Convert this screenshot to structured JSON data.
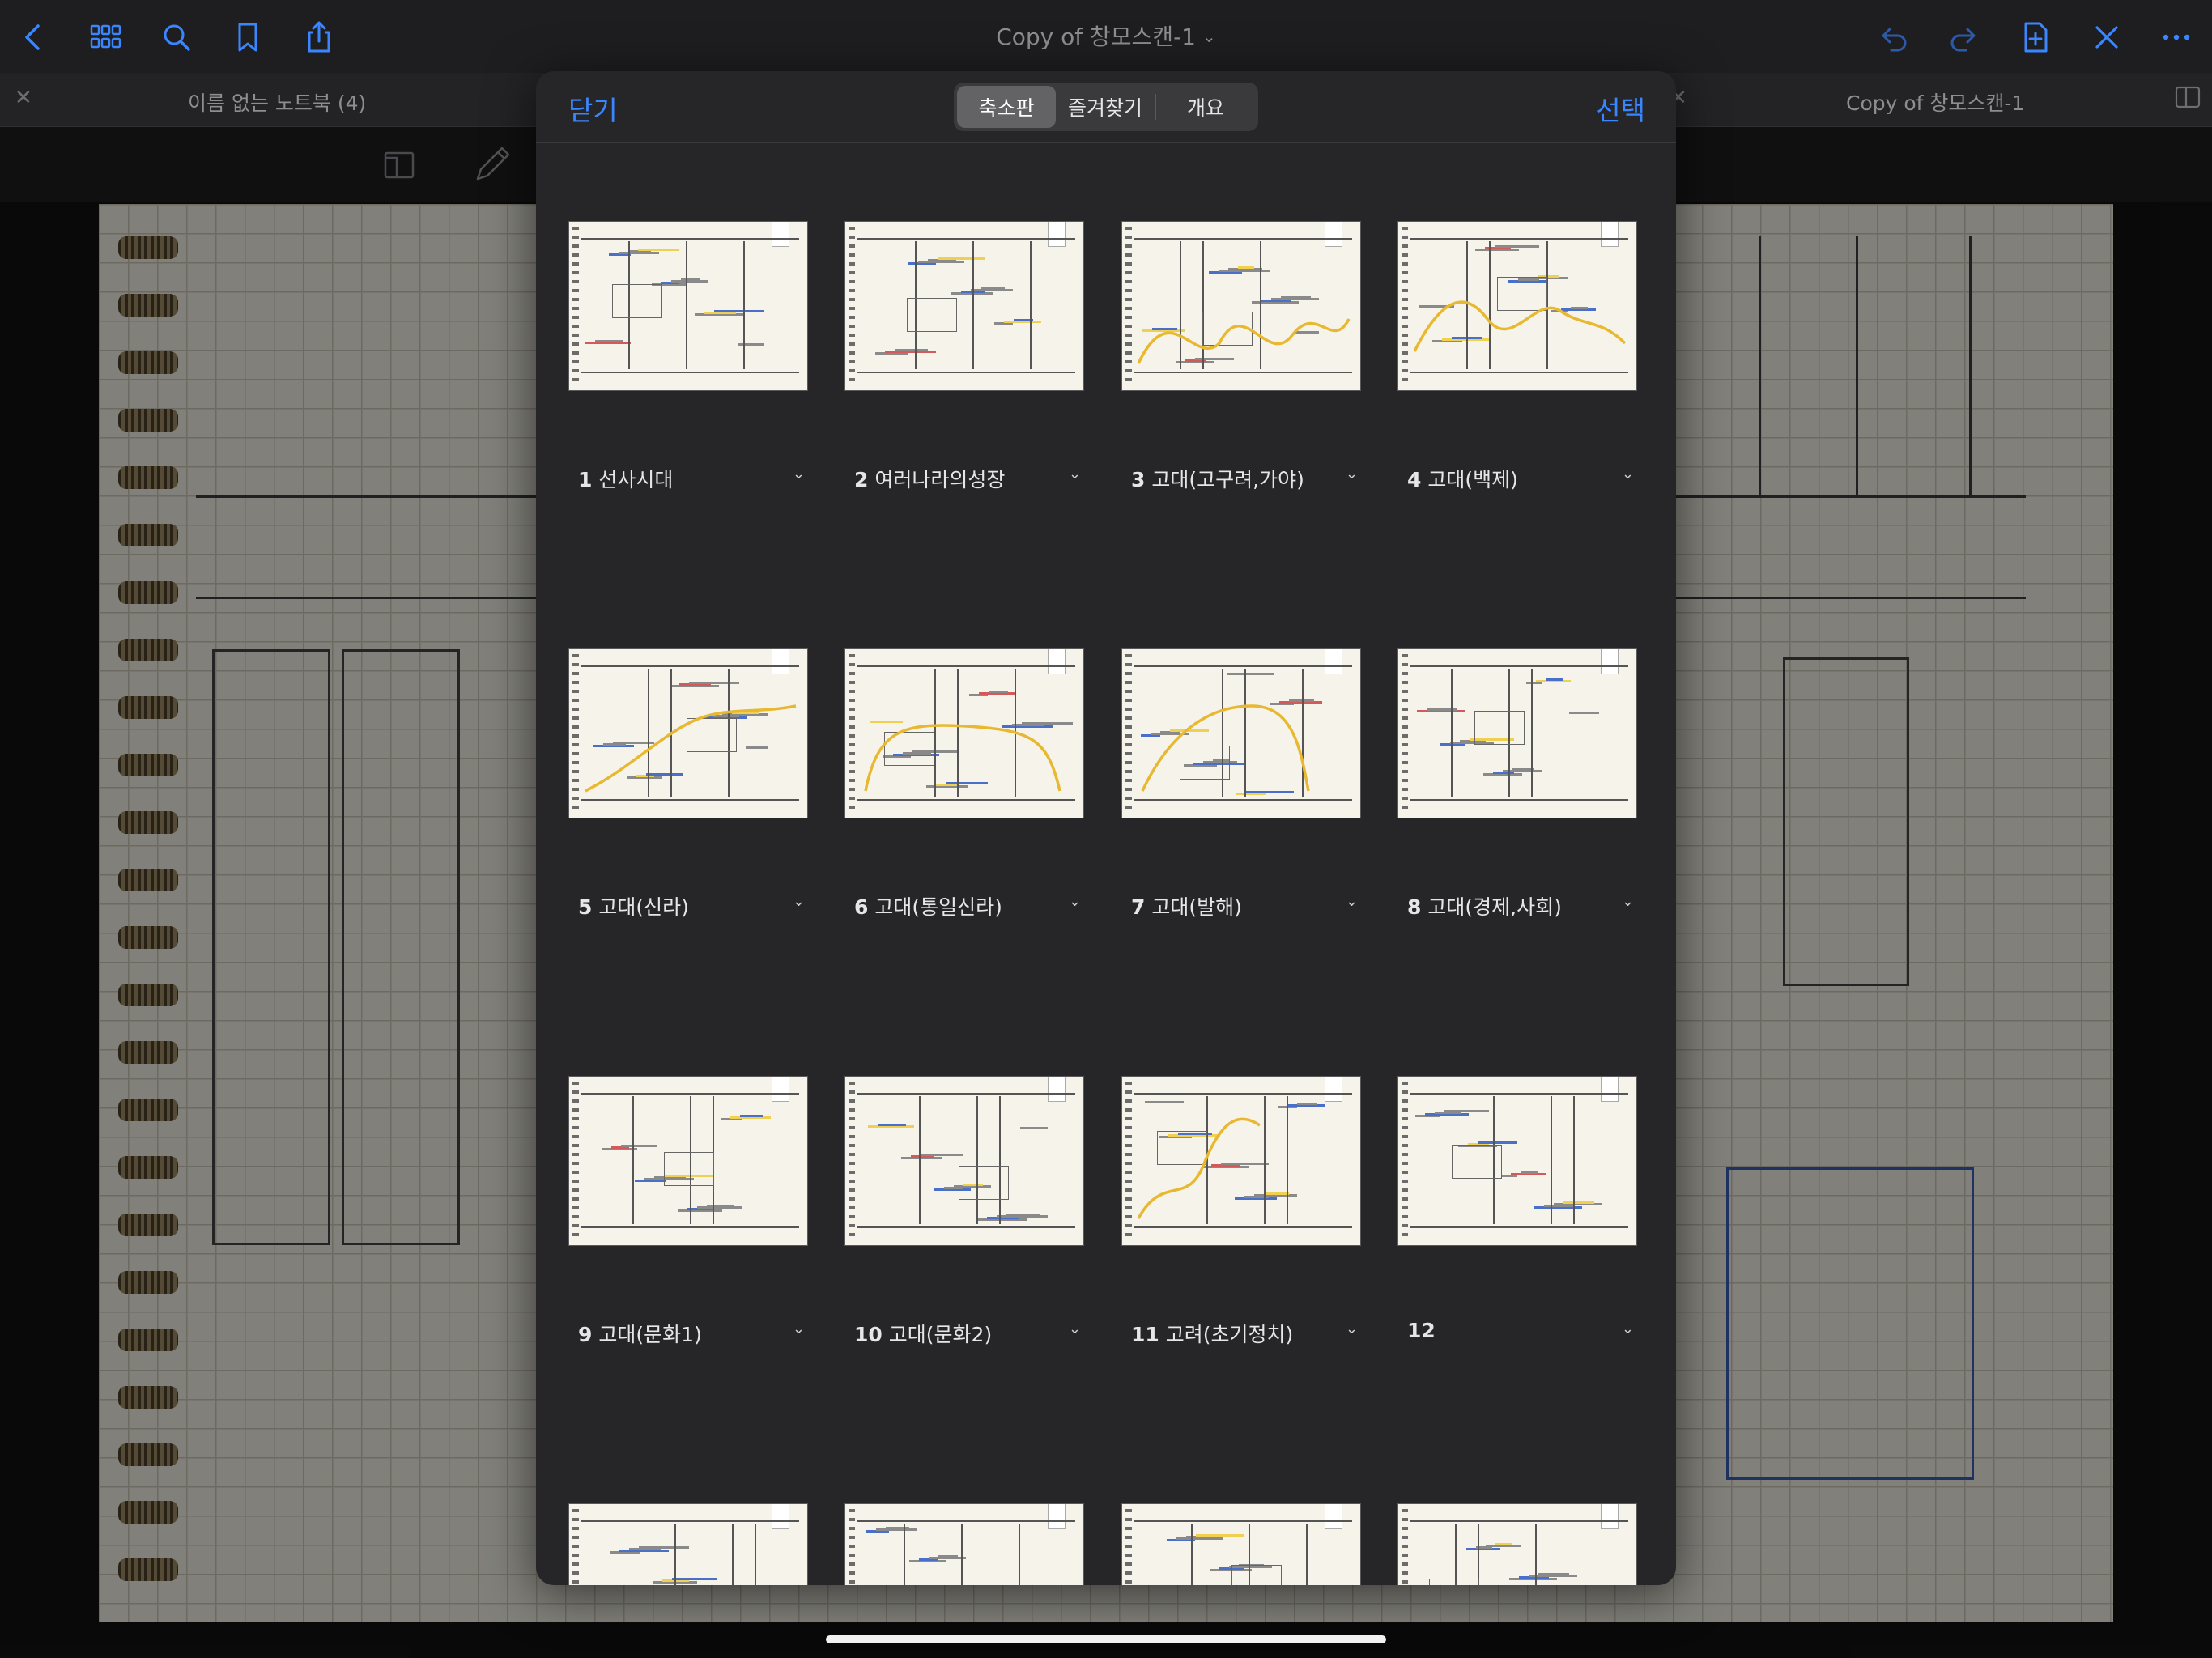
{
  "toolbar": {
    "title": "Copy of 창모스캔-1",
    "icons": [
      "back-icon",
      "grid-icon",
      "search-icon",
      "bookmark-icon",
      "share-icon",
      "undo-icon",
      "redo-icon",
      "add-page-icon",
      "close-icon",
      "more-icon"
    ],
    "accent": "#3a86ff"
  },
  "tabs": [
    {
      "label": "이름 없는 노트북 (4)"
    },
    {
      "label": "Copy of 창모스캔-1"
    }
  ],
  "modal": {
    "close_label": "닫기",
    "select_label": "선택",
    "segments": [
      "축소판",
      "즐겨찾기",
      "개요"
    ],
    "active_segment": "축소판",
    "pages": [
      {
        "num": "1",
        "title": "선사시대"
      },
      {
        "num": "2",
        "title": "여러나라의성장"
      },
      {
        "num": "3",
        "title": "고대(고구려,가야)"
      },
      {
        "num": "4",
        "title": "고대(백제)"
      },
      {
        "num": "5",
        "title": "고대(신라)"
      },
      {
        "num": "6",
        "title": "고대(통일신라)"
      },
      {
        "num": "7",
        "title": "고대(발해)"
      },
      {
        "num": "8",
        "title": "고대(경제,사회)"
      },
      {
        "num": "9",
        "title": "고대(문화1)"
      },
      {
        "num": "10",
        "title": "고대(문화2)"
      },
      {
        "num": "11",
        "title": "고려(초기정치)"
      },
      {
        "num": "12",
        "title": ""
      }
    ]
  }
}
